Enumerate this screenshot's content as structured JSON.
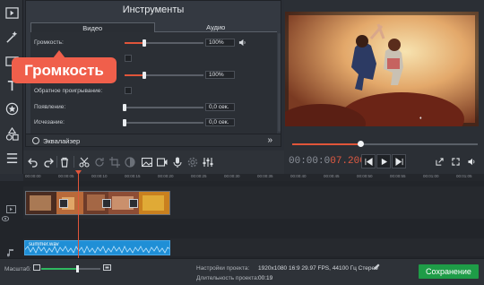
{
  "panel": {
    "title": "Инструменты",
    "tabs": [
      {
        "label": "Видео",
        "active": true
      },
      {
        "label": "Аудио",
        "active": false
      }
    ],
    "rows": {
      "volume": {
        "label": "Громкость:",
        "value": "100%",
        "level": 0.25
      },
      "row2": {
        "value": "100%",
        "level": 0.25
      },
      "reverse": {
        "label": "Обратное проигрывание:",
        "checked": false
      },
      "fade_in": {
        "label": "Появление:",
        "value": "0,0 сек.",
        "level": 0.0
      },
      "fade_out": {
        "label": "Исчезание:",
        "value": "0,0 сек.",
        "level": 0.0
      }
    },
    "equalizer": {
      "label": "Эквалайзер"
    }
  },
  "tooltip": {
    "text": "Громкость"
  },
  "player": {
    "progress": 0.36,
    "timecode": {
      "gray": "00:00:0",
      "red": "07.200"
    }
  },
  "ruler": {
    "ticks": [
      "00:00:00",
      "00:00:05",
      "00:00:10",
      "00:00:15",
      "00:00:20",
      "00:00:25",
      "00:00:30",
      "00:00:35",
      "00:00:40",
      "00:00:45",
      "00:00:50",
      "00:00:55",
      "00:01:00",
      "00:01:05"
    ]
  },
  "timeline": {
    "audio_clip": {
      "label": "summer.wav"
    }
  },
  "status": {
    "zoom_label": "Масштаб:",
    "zoom_level": 0.62,
    "settings_label": "Настройки проекта:",
    "settings_value": "1920x1080 16:9 29.97 FPS, 44100 Гц Стерео",
    "duration_label": "Длительность проекта:",
    "duration_value": "00:19",
    "save_label": "Сохранение"
  },
  "colors": {
    "accent": "#e0553a",
    "tooltip": "#f05f4b",
    "audio_clip": "#1f8fd6",
    "save": "#1e9c47"
  }
}
